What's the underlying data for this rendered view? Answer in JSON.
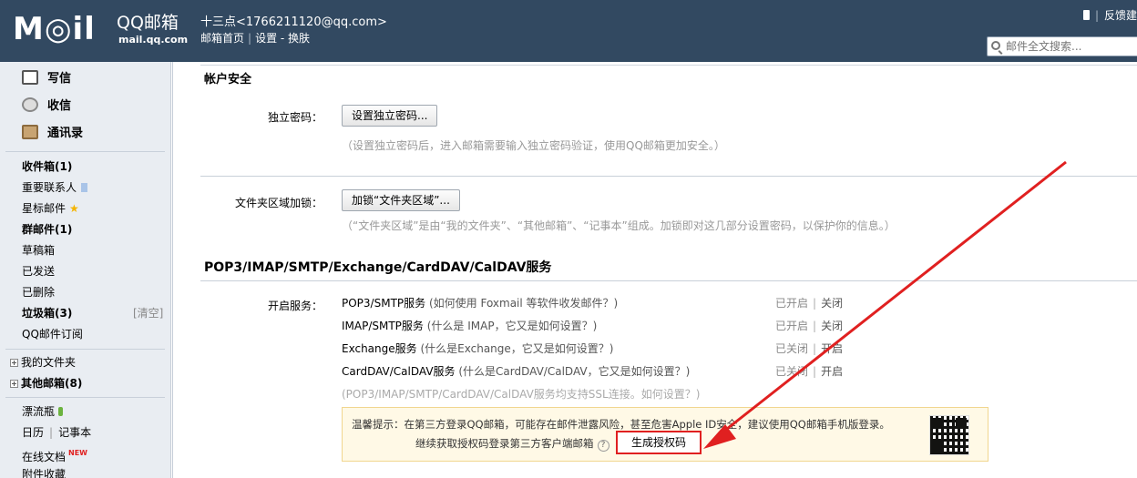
{
  "header": {
    "logo_mail": "M◎il",
    "logo_qq": "QQ邮箱",
    "logo_domain": "mail.qq.com",
    "user_line": "十三点<1766211120@qq.com>",
    "nav": [
      "邮箱首页",
      "设置",
      "换肤"
    ],
    "feedback": "反馈建",
    "search_placeholder": "邮件全文搜索..."
  },
  "sidebar": {
    "quick": [
      "写信",
      "收信",
      "通讯录"
    ],
    "folders": {
      "inbox": "收件箱(1)",
      "vip": "重要联系人",
      "starred": "星标邮件",
      "groups": "群邮件(1)",
      "drafts": "草稿箱",
      "sent": "已发送",
      "deleted": "已删除",
      "spam": "垃圾箱(3)",
      "spam_clear": "[清空]",
      "subscribe": "QQ邮件订阅",
      "my_folders": "我的文件夹",
      "other_mail": "其他邮箱(8)",
      "bottle": "漂流瓶",
      "calendar": "日历",
      "notes": "记事本",
      "docs": "在线文档",
      "docs_badge": "NEW",
      "attachments": "附件收藏"
    }
  },
  "main": {
    "account_security_title": "帐户安全",
    "independent_password_label": "独立密码：",
    "independent_password_button": "设置独立密码...",
    "independent_password_hint": "（设置独立密码后，进入邮箱需要输入独立密码验证，使用QQ邮箱更加安全。）",
    "folder_lock_label": "文件夹区域加锁：",
    "folder_lock_button": "加锁“文件夹区域”...",
    "folder_lock_hint": "（“文件夹区域”是由“我的文件夹”、“其他邮箱”、“记事本”组成。加锁即对这几部分设置密码，以保护你的信息。）",
    "services_title": "POP3/IMAP/SMTP/Exchange/CardDAV/CalDAV服务",
    "services_label": "开启服务：",
    "services": [
      {
        "name": "POP3/SMTP服务",
        "help": "(如何使用 Foxmail 等软件收发邮件？)",
        "status": "已开启",
        "action": "关闭"
      },
      {
        "name": "IMAP/SMTP服务",
        "help": "(什么是 IMAP，它又是如何设置？)",
        "status": "已开启",
        "action": "关闭"
      },
      {
        "name": "Exchange服务",
        "help": "(什么是Exchange，它又是如何设置？)",
        "status": "已关闭",
        "action": "开启"
      },
      {
        "name": "CardDAV/CalDAV服务",
        "help": "(什么是CardDAV/CalDAV，它又是如何设置？)",
        "status": "已关闭",
        "action": "开启"
      }
    ],
    "ssl_note": "(POP3/IMAP/SMTP/CardDAV/CalDAV服务均支持SSL连接。如何设置？)",
    "tip_line1": "温馨提示：在第三方登录QQ邮箱，可能存在邮件泄露风险，甚至危害Apple ID安全，建议使用QQ邮箱手机版登录。",
    "tip_line2": "继续获取授权码登录第三方客户端邮箱",
    "tip_qmark": "?",
    "generate_code_button": "生成授权码"
  },
  "colors": {
    "header_bg": "#324961",
    "sidebar_bg": "#e9edf2",
    "tip_bg": "#fff9e6",
    "highlight_red": "#e02020"
  }
}
